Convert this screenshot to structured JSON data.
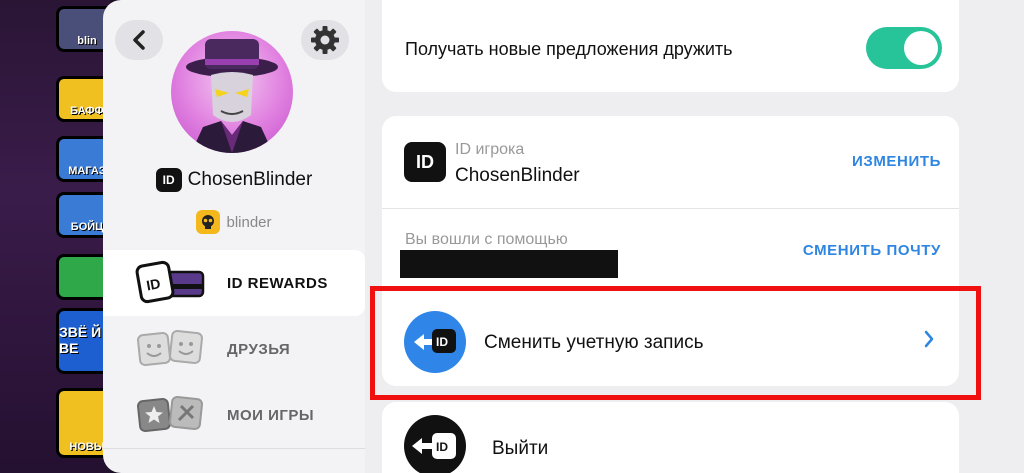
{
  "game_sidebar": {
    "buttons": [
      "blin",
      "БАФФ",
      "МАГАЗ",
      "БОЙЦ",
      "",
      "ЗВЁ Й ВЕ",
      "НОВЫ"
    ]
  },
  "profile": {
    "name": "ChosenBlinder",
    "id_badge": "ID",
    "game_account": "blinder"
  },
  "nav": {
    "items": [
      {
        "label": "ID REWARDS",
        "active": true
      },
      {
        "label": "ДРУЗЬЯ",
        "active": false
      },
      {
        "label": "МОИ ИГРЫ",
        "active": false
      }
    ]
  },
  "settings": {
    "suggest_friends_label": "Получать новые предложения дружить",
    "suggest_friends_on": true
  },
  "account": {
    "id_badge": "ID",
    "id_caption": "ID игрока",
    "id_value": "ChosenBlinder",
    "change_label": "ИЗМЕНИТЬ",
    "login_caption": "Вы вошли с помощью",
    "change_email_label": "СМЕНИТЬ ПОЧТУ",
    "switch_account_label": "Сменить учетную запись",
    "logout_label": "Выйти"
  },
  "colors": {
    "toggle_on": "#27c49a",
    "link": "#2e86e0",
    "switch_icon_bg": "#2f86e8",
    "highlight": "#f01010"
  },
  "icons": {
    "back": "chevron-left-icon",
    "settings": "gear-icon",
    "switch": "switch-account-icon",
    "logout": "logout-icon",
    "chevron": "chevron-right-icon"
  }
}
